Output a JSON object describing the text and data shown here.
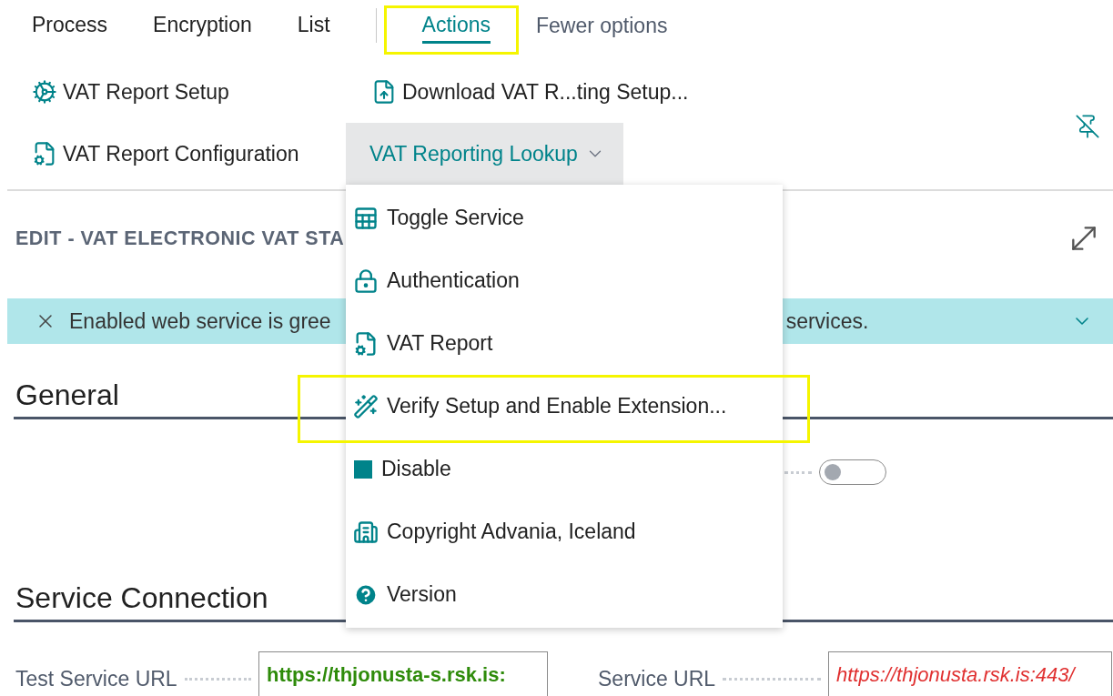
{
  "tabs": [
    {
      "label": "Process",
      "kind": "category",
      "selected": false,
      "highlighted": false
    },
    {
      "label": "Encryption",
      "kind": "category",
      "selected": false,
      "highlighted": false
    },
    {
      "label": "List",
      "kind": "category",
      "selected": false,
      "highlighted": false
    },
    {
      "label": "Actions",
      "kind": "actions",
      "selected": true,
      "highlighted": true
    }
  ],
  "fewer_options_link": "Fewer options",
  "actions": [
    {
      "kind": "action",
      "label": "VAT Report Setup"
    },
    {
      "kind": "action",
      "label": "Download VAT R...ting Setup..."
    },
    {
      "kind": "action",
      "label": "VAT Report Configuration"
    },
    {
      "kind": "dropdown",
      "label": "VAT Reporting Lookup",
      "expanded": true,
      "items": [
        {
          "label": "Toggle Service",
          "highlighted": false
        },
        {
          "label": "Authentication",
          "highlighted": false
        },
        {
          "label": "VAT Report",
          "highlighted": false
        },
        {
          "label": "Verify Setup and Enable Extension...",
          "highlighted": true
        },
        {
          "label": "Disable",
          "highlighted": false
        },
        {
          "label": "Copyright Advania, Iceland",
          "highlighted": false
        },
        {
          "label": "Version",
          "highlighted": false
        }
      ]
    }
  ],
  "page_title": "EDIT - VAT ELECTRONIC VAT STA",
  "banner": {
    "text_start": "Enabled web service is gree",
    "text_end": "services."
  },
  "sections": [
    {
      "title": "General",
      "fields": [
        {
          "kind": "toggle",
          "on": false
        }
      ]
    },
    {
      "title": "Service Connection",
      "fields": [
        {
          "kind": "url",
          "label": "Test Service URL",
          "value": "https://thjonusta-s.rsk.is:",
          "valid": true
        },
        {
          "kind": "url",
          "label": "Service URL",
          "value": "https://thjonusta.rsk.is:443/",
          "valid": false
        }
      ]
    }
  ]
}
